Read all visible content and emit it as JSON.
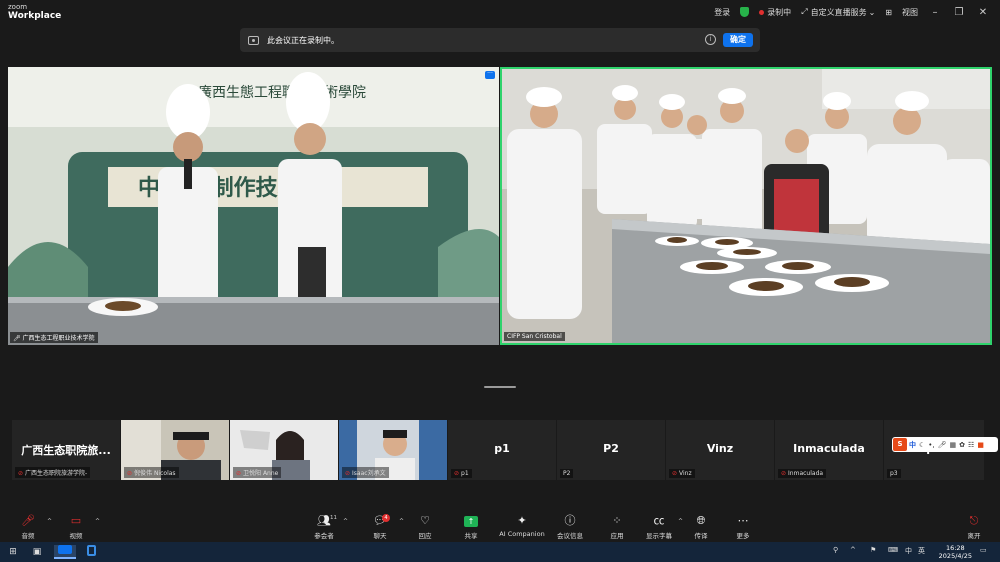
{
  "app": {
    "logo_line1": "zoom",
    "logo_line2": "Workplace"
  },
  "titlebar": {
    "login": "登录",
    "recording": "录制中",
    "live_service": "自定义直播服务",
    "view": "视图"
  },
  "banner": {
    "text": "此会议正在录制中。",
    "confirm": "确定"
  },
  "videos": {
    "left_name": "广西生态工程职业技术学院",
    "right_name": "CIFP San Cristobal"
  },
  "participants": [
    {
      "display": "广西生态职院旅...",
      "name": "广西生态职院旅游学院-",
      "type": "text"
    },
    {
      "display": "",
      "name": "倪俊伟 Nicolas",
      "type": "cam"
    },
    {
      "display": "",
      "name": "卫悦阳 Anne",
      "type": "cam"
    },
    {
      "display": "",
      "name": "Isaac刘承文",
      "type": "cam"
    },
    {
      "display": "p1",
      "name": "p1",
      "type": "text"
    },
    {
      "display": "P2",
      "name": "P2",
      "type": "text"
    },
    {
      "display": "Vinz",
      "name": "Vinz",
      "type": "text"
    },
    {
      "display": "Inmaculada",
      "name": "Inmaculada",
      "type": "text"
    },
    {
      "display": "p3",
      "name": "p3",
      "type": "text"
    }
  ],
  "ime": {
    "lang": "中"
  },
  "toolbar": {
    "audio": "音频",
    "video": "视频",
    "participants": "参会者",
    "participants_count": "11",
    "chat": "聊天",
    "chat_badge": "4",
    "react": "回应",
    "share": "共享",
    "ai": "AI Companion",
    "info": "会议信息",
    "apps": "应用",
    "captions": "显示字幕",
    "translate": "传译",
    "more": "更多",
    "leave": "离开"
  },
  "taskbar": {
    "ime_lang": "中",
    "ime_mode": "英",
    "time": "16:28",
    "date": "2025/4/25"
  },
  "colors": {
    "accent": "#0e72ed",
    "recording": "#e02f2f",
    "active_speaker": "#2fd36c",
    "share": "#1fb356"
  }
}
